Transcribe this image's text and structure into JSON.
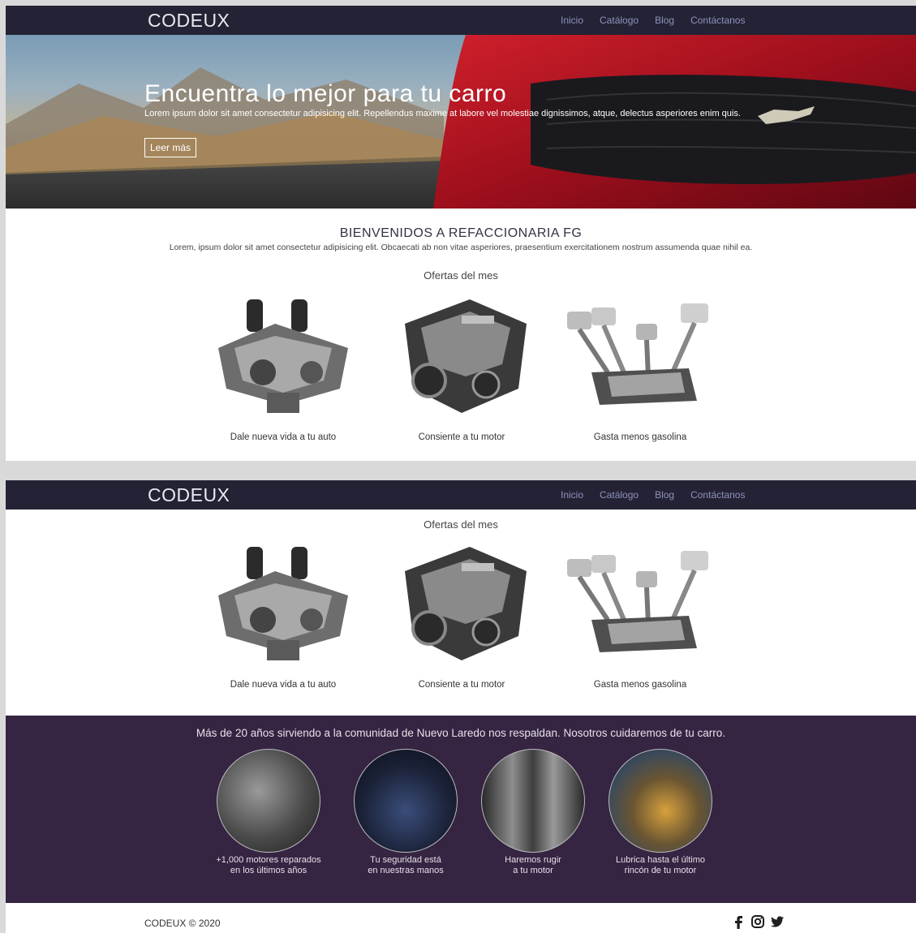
{
  "brand": "CODEUX",
  "nav": [
    "Inicio",
    "Catálogo",
    "Blog",
    "Contáctanos"
  ],
  "hero": {
    "title": "Encuentra lo mejor para tu carro",
    "text": "Lorem ipsum dolor sit amet consectetur adipisicing elit. Repellendus maxime at labore vel molestiae dignissimos, atque, delectus asperiores enim quis.",
    "button": "Leer más"
  },
  "welcome": {
    "title": "BIENVENIDOS A REFACCIONARIA FG",
    "text": "Lorem, ipsum dolor sit amet consectetur adipisicing elit. Obcaecati ab non vitae asperiores, praesentium exercitationem nostrum assumenda quae nihil ea."
  },
  "offers": {
    "title": "Ofertas del mes",
    "items": [
      "Dale nueva vida a tu auto",
      "Consiente a tu motor",
      "Gasta menos gasolina"
    ]
  },
  "services": {
    "title": "Más de 20 años sirviendo a la comunidad de Nuevo Laredo nos respaldan. Nosotros cuidaremos de tu carro.",
    "items": [
      {
        "line1": "+1,000 motores reparados",
        "line2": "en los últimos años"
      },
      {
        "line1": "Tu seguridad está",
        "line2": "en nuestras manos"
      },
      {
        "line1": "Haremos rugir",
        "line2": "a tu motor"
      },
      {
        "line1": "Lubrica hasta el último",
        "line2": "rincón de tu motor"
      }
    ]
  },
  "footer": {
    "copyright": "CODEUX © 2020",
    "social_icons": [
      "facebook-icon",
      "instagram-icon",
      "twitter-icon"
    ]
  },
  "colors": {
    "navbar": "#232335",
    "nav_link": "#8f91bd",
    "services_bg": "#352442"
  }
}
